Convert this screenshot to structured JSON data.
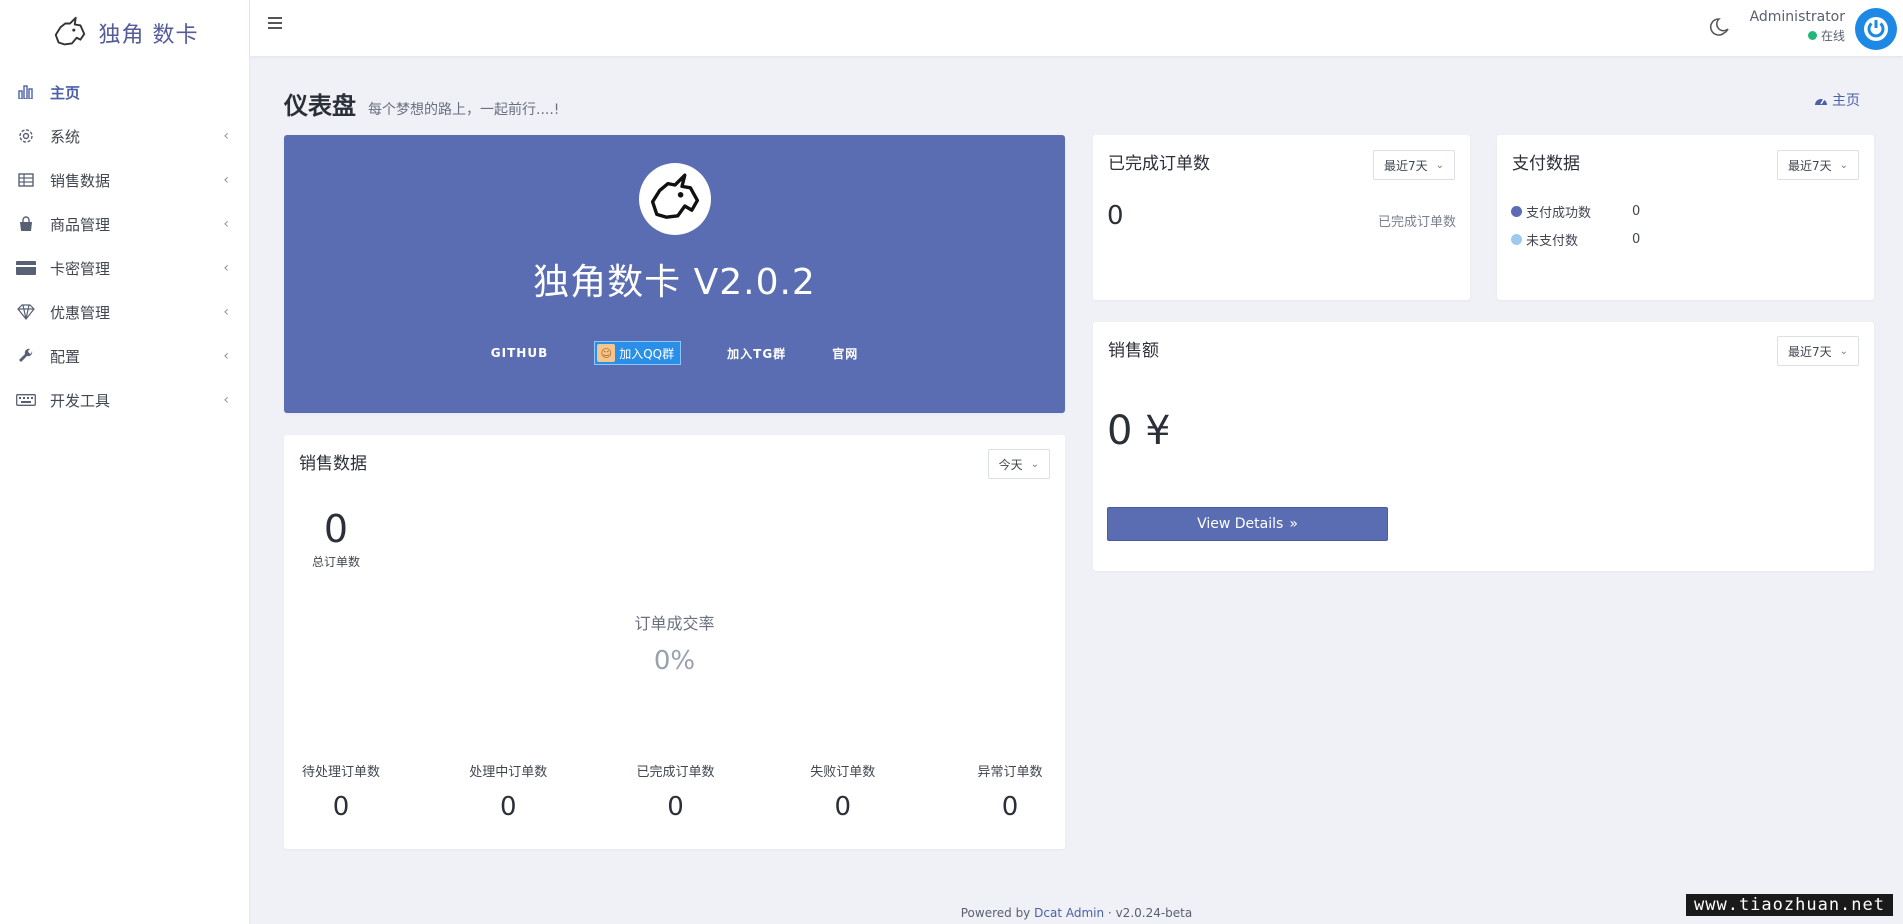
{
  "brand": {
    "name": "独角 数卡"
  },
  "sidebar": {
    "items": [
      {
        "label": "主页",
        "icon": "bar-chart-icon",
        "active": true
      },
      {
        "label": "系统",
        "icon": "gear-icon"
      },
      {
        "label": "销售数据",
        "icon": "table-icon"
      },
      {
        "label": "商品管理",
        "icon": "shopping-bag-icon"
      },
      {
        "label": "卡密管理",
        "icon": "credit-card-icon"
      },
      {
        "label": "优惠管理",
        "icon": "diamond-icon"
      },
      {
        "label": "配置",
        "icon": "wrench-icon"
      },
      {
        "label": "开发工具",
        "icon": "keyboard-icon"
      }
    ]
  },
  "topbar": {
    "user_name": "Administrator",
    "user_status": "在线"
  },
  "header": {
    "title": "仪表盘",
    "subtitle": "每个梦想的路上，一起前行....!",
    "breadcrumb": "主页"
  },
  "banner": {
    "title": "独角数卡 V2.0.2",
    "links": {
      "github": "GITHUB",
      "qq": "加入QQ群",
      "tg": "加入TG群",
      "site": "官网"
    }
  },
  "sales_card": {
    "title": "销售数据",
    "range": "今天",
    "total_value": "0",
    "total_label": "总订单数",
    "rate_label": "订单成交率",
    "rate_value": "0%",
    "stats": [
      {
        "label": "待处理订单数",
        "value": "0"
      },
      {
        "label": "处理中订单数",
        "value": "0"
      },
      {
        "label": "已完成订单数",
        "value": "0"
      },
      {
        "label": "失败订单数",
        "value": "0"
      },
      {
        "label": "异常订单数",
        "value": "0"
      }
    ]
  },
  "completed_card": {
    "title": "已完成订单数",
    "range": "最近7天",
    "value": "0",
    "side_label": "已完成订单数"
  },
  "payment_card": {
    "title": "支付数据",
    "range": "最近7天",
    "legend": [
      {
        "label": "支付成功数",
        "value": "0",
        "color": "#5b6db2"
      },
      {
        "label": "未支付数",
        "value": "0",
        "color": "#9fc8ee"
      }
    ]
  },
  "revenue_card": {
    "title": "销售额",
    "range": "最近7天",
    "value": "0 ¥",
    "button": "View Details"
  },
  "footer": {
    "prefix": "Powered by",
    "link": "Dcat Admin",
    "version": "v2.0.24-beta"
  },
  "watermark": "www.tiaozhuan.net"
}
